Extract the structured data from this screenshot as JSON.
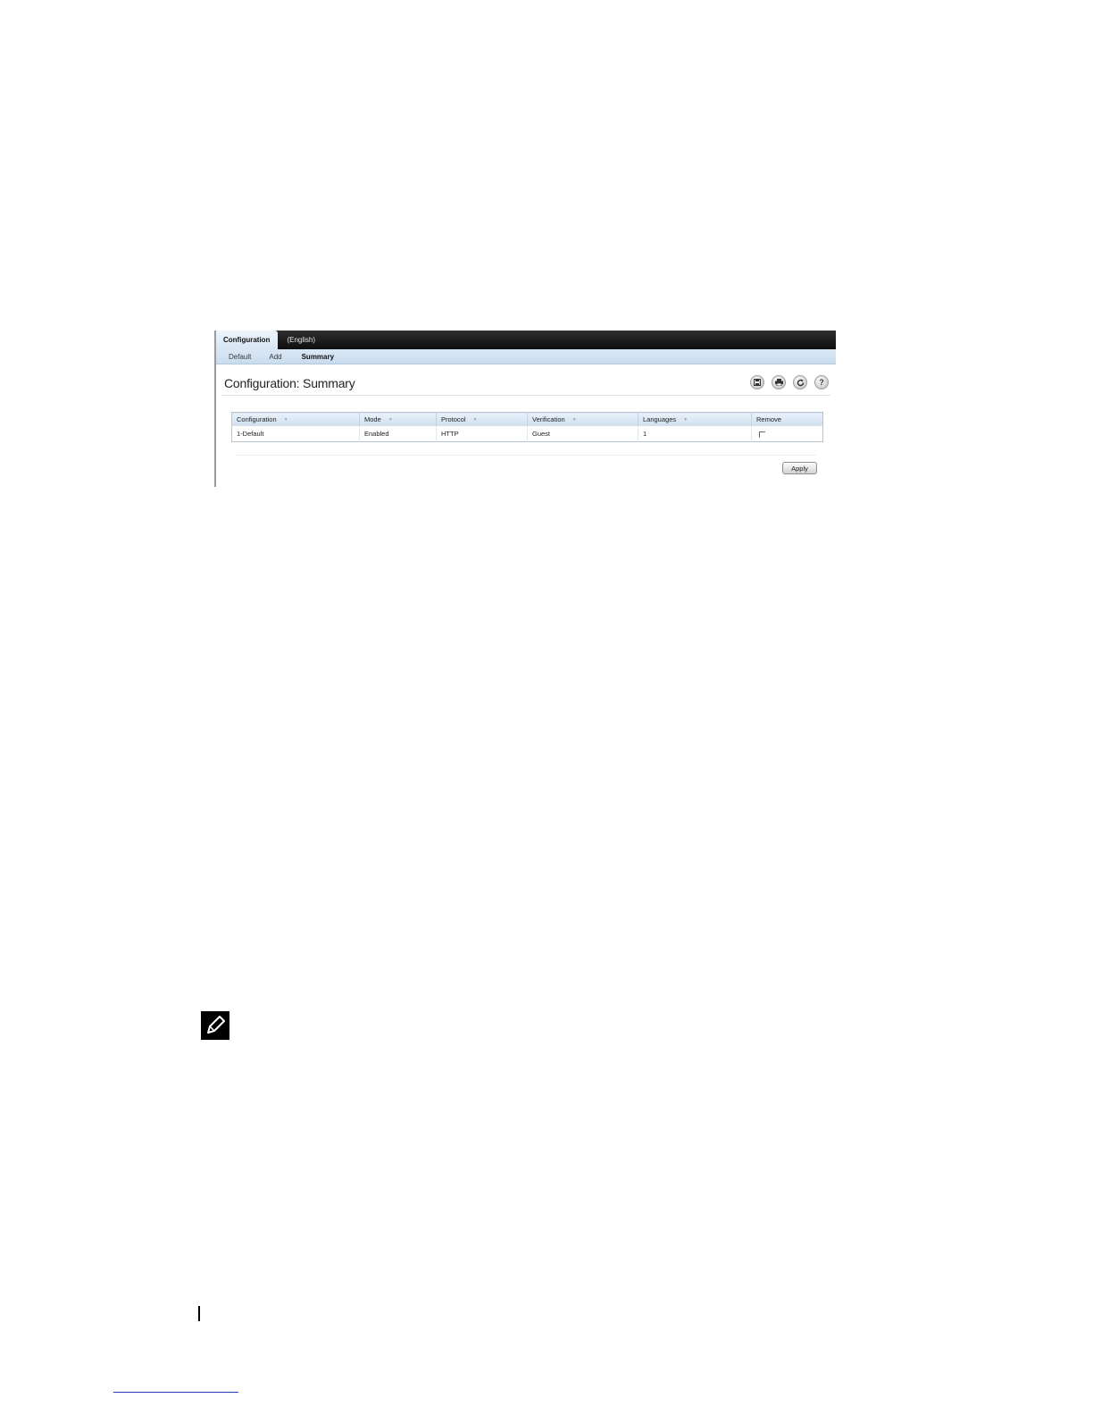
{
  "tabs": {
    "active": "Configuration",
    "inactive": "(English)"
  },
  "subnav": [
    "Default",
    "Add",
    "Summary"
  ],
  "page_title": "Configuration: Summary",
  "toolbar": {
    "save": "save-icon",
    "print": "print-icon",
    "refresh": "refresh-icon",
    "help": "?"
  },
  "table": {
    "headers": [
      "Configuration",
      "Mode",
      "Protocol",
      "Verification",
      "Languages",
      "Remove"
    ],
    "rows": [
      [
        "1-Default",
        "Enabled",
        "HTTP",
        "Guest",
        "1"
      ]
    ]
  },
  "apply_label": "Apply",
  "colors": {
    "topbar": "#0e0e0e",
    "subnav": "#c8dcee",
    "header_row": "#cfdff0"
  }
}
